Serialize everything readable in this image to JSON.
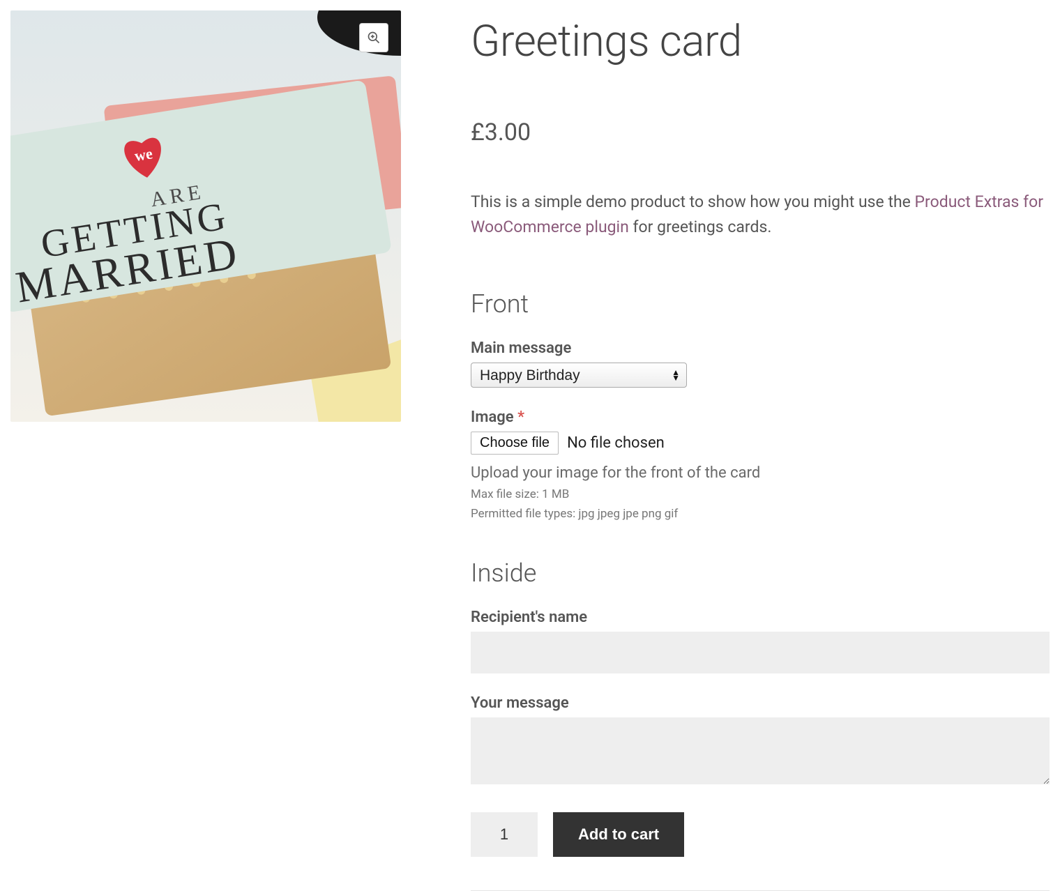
{
  "product": {
    "title": "Greetings card",
    "price": "£3.00",
    "description_prefix": "This is a simple demo product to show how you might use the ",
    "description_link": "Product Extras for WooCommerce plugin",
    "description_suffix": " for greetings cards."
  },
  "sections": {
    "front": {
      "heading": "Front",
      "main_message": {
        "label": "Main message",
        "selected": "Happy Birthday"
      },
      "image": {
        "label": "Image",
        "required_mark": "*",
        "choose_button": "Choose file",
        "status": "No file chosen",
        "hint": "Upload your image for the front of the card",
        "max_size": "Max file size: 1 MB",
        "file_types": "Permitted file types: jpg jpeg jpe png gif"
      }
    },
    "inside": {
      "heading": "Inside",
      "recipient_label": "Recipient's name",
      "message_label": "Your message"
    }
  },
  "cart": {
    "quantity": "1",
    "add_label": "Add to cart"
  },
  "icons": {
    "zoom": "magnifier-plus-icon"
  }
}
